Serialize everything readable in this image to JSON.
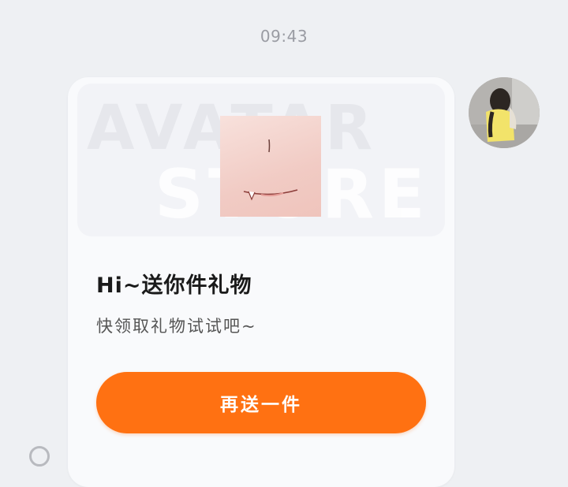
{
  "chat": {
    "timestamp": "09:43"
  },
  "avatar": {
    "icon": "user-avatar-photo"
  },
  "card": {
    "banner_watermark_1": "AVATAR",
    "banner_watermark_2": "STORE",
    "product_icon": "face-sticker-mouth-fang",
    "title": "Hi~送你件礼物",
    "subtitle": "快领取礼物试试吧~",
    "button_label": "再送一件",
    "accent_color": "#ff7112"
  },
  "select": {
    "icon": "radio-unchecked-icon"
  }
}
